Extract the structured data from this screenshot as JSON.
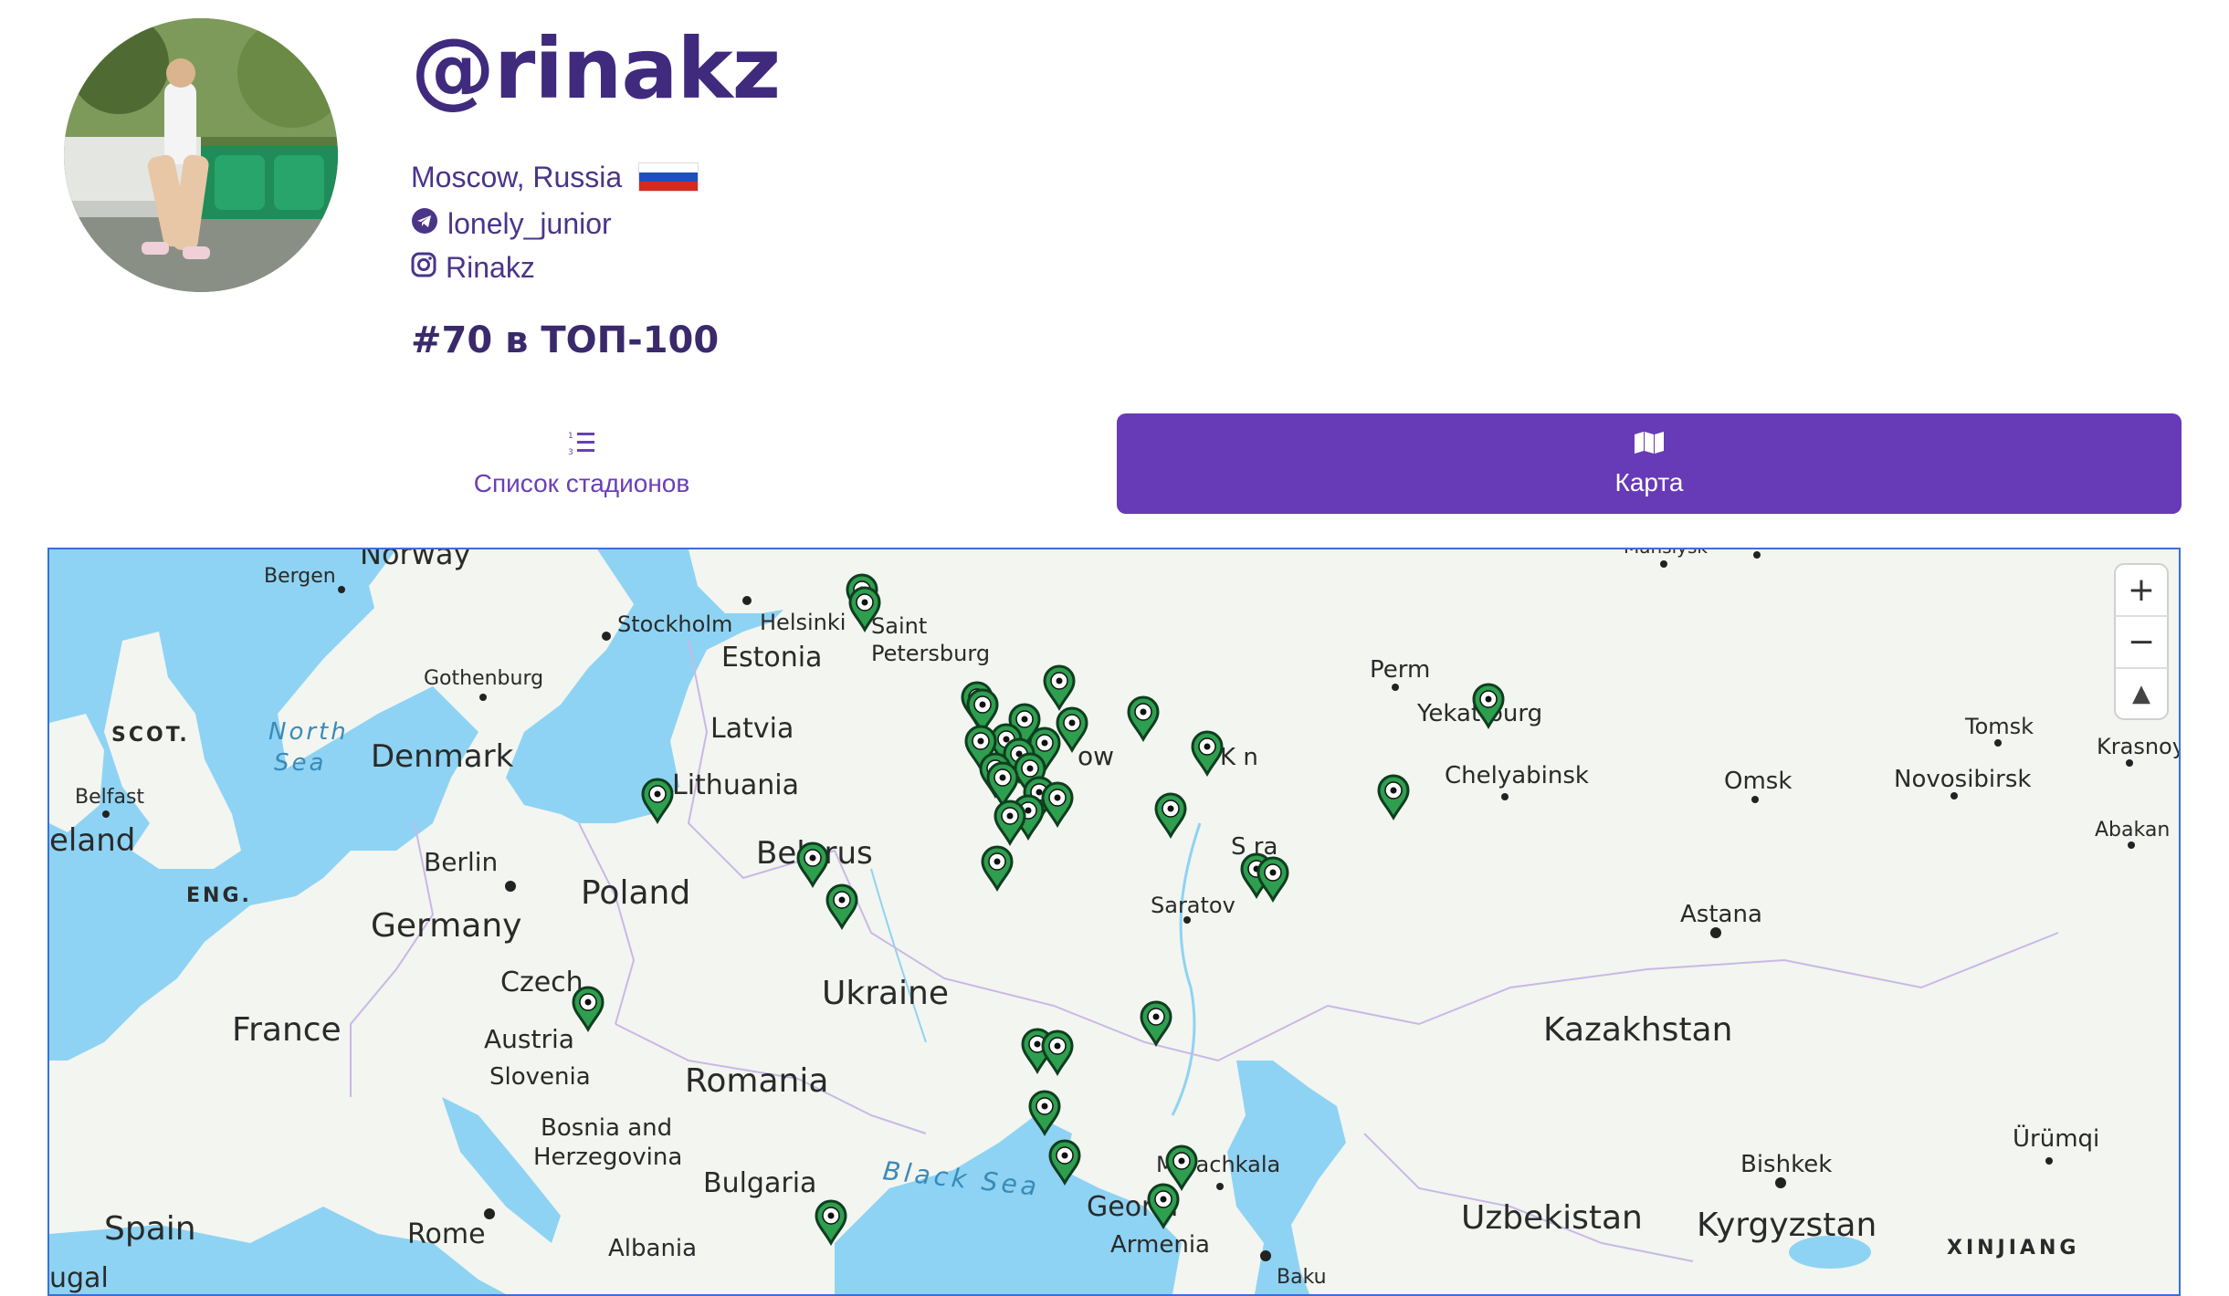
{
  "profile": {
    "username": "@rinakz",
    "location": "Moscow, Russia",
    "telegram": "lonely_junior",
    "instagram": "Rinakz",
    "rank": "#70 в ТОП-100"
  },
  "tabs": {
    "list_label": "Список стадионов",
    "map_label": "Карта"
  },
  "map": {
    "zoom_in": "+",
    "zoom_out": "−",
    "compass": "▲",
    "labels": {
      "norway": "Norway",
      "bergen": "Bergen",
      "stockholm": "Stockholm",
      "helsinki": "Helsinki",
      "saint": "Saint",
      "petersburg": "Petersburg",
      "estonia": "Estonia",
      "gothenburg": "Gothenburg",
      "scot": "SCOT.",
      "north": "North",
      "sea": "Sea",
      "denmark": "Denmark",
      "latvia": "Latvia",
      "lithuania": "Lithuania",
      "belfast": "Belfast",
      "ireland": "eland",
      "eng": "ENG.",
      "berlin": "Berlin",
      "poland": "Poland",
      "belarus": "Belarus",
      "germany": "Germany",
      "czech": "Czech",
      "ukraine": "Ukraine",
      "france": "France",
      "austria": "Austria",
      "slovenia": "Slovenia",
      "romania": "Romania",
      "bosnia1": "Bosnia and",
      "bosnia2": "Herzegovina",
      "bulgaria": "Bulgaria",
      "black_sea": "Black Sea",
      "spain": "Spain",
      "rome": "Rome",
      "albania": "Albania",
      "moscow_tail": "ow",
      "kazan": "K     n",
      "perm": "Perm",
      "yekat": "Yekat        burg",
      "chelyabinsk": "Chelyabinsk",
      "samara": "S        ra",
      "saratov": "Saratov",
      "omsk": "Omsk",
      "novosibirsk": "Novosibirsk",
      "tomsk": "Tomsk",
      "krasnoyarsk": "Krasnoya",
      "abakan": "Abakan",
      "astana": "Astana",
      "kazakhstan": "Kazakhstan",
      "makhachkala": "M    hachkala",
      "georgia": "Geor   a",
      "armenia": "Armenia",
      "uzbekistan": "Uzbekistan",
      "kyrgyzstan": "Kyrgyzstan",
      "bishkek": "Bishkek",
      "urumqi": "Ürümqi",
      "xinjiang": "XINJIANG",
      "baku": "Baku",
      "portugal": "ugal",
      "mansiysk": "Mansiysk"
    },
    "colors": {
      "water": "#8ed3f3",
      "land": "#f3f5f0",
      "land2": "#eef2ea",
      "pin": "#2e9e4f",
      "pin_dark": "#0f3d1f"
    }
  }
}
